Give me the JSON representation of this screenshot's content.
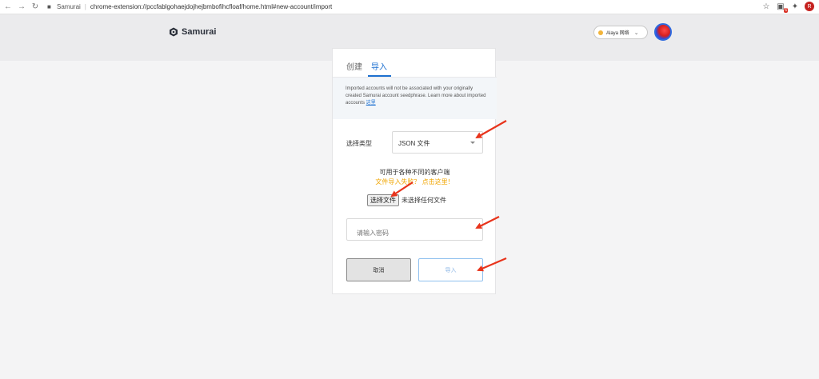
{
  "browser": {
    "tab_title": "Samurai",
    "url": "chrome-extension://pccfablgohaejdojhejbmbofihcfloaf/home.html#new-account/import",
    "extension_badge": "6",
    "profile_initial": "R"
  },
  "header": {
    "app_name": "Samurai",
    "network_label": "Alaya 网络",
    "network_dot_color": "#f2b43a"
  },
  "tabs": [
    {
      "label": "创建",
      "active": false
    },
    {
      "label": "导入",
      "active": true
    }
  ],
  "notice": {
    "text": "Imported accounts will not be associated with your originally created Samurai account seedphrase. Learn more about imported accounts",
    "link_text": "这里"
  },
  "form": {
    "type_label": "选择类型",
    "type_value": "JSON 文件",
    "hint_line1": "可用于各种不同的客户端",
    "hint_line2": "文件导入失败？ 点击这里！",
    "file_button": "选择文件",
    "file_status": "未选择任何文件",
    "password_placeholder": "请输入密码",
    "cancel_label": "取消",
    "import_label": "导入"
  },
  "colors": {
    "accent": "#1d70d0",
    "warning": "#f0a500",
    "arrow": "#e8341c"
  }
}
